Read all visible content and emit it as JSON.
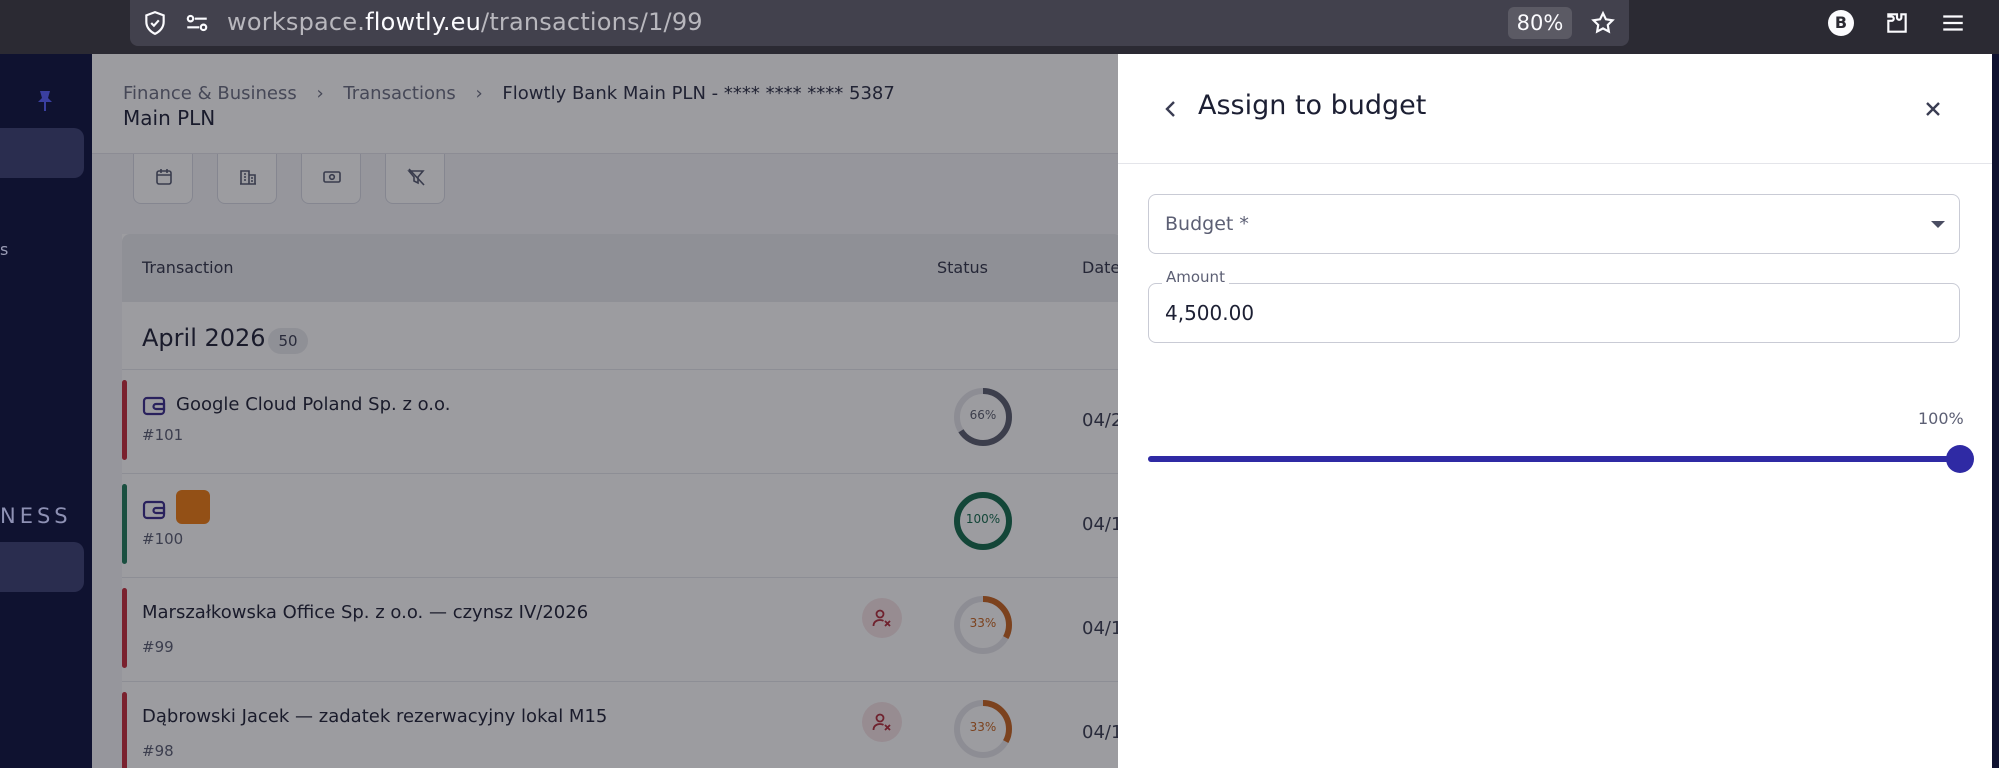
{
  "browser": {
    "url_prefix": "workspace.",
    "url_domain": "flowtly.eu",
    "url_path": "/transactions/1/99",
    "zoom": "80%",
    "profile_initial": "B"
  },
  "breadcrumb": {
    "items": [
      "Finance & Business",
      "Transactions",
      "Flowtly Bank Main PLN - **** **** **** 5387"
    ],
    "page_title": "Main PLN"
  },
  "sidebar": {
    "section_partial": "NESS",
    "item_partial": "s"
  },
  "table": {
    "columns": [
      "Transaction",
      "Status",
      "Date"
    ],
    "month": "April 2026",
    "month_count": "50",
    "rows": [
      {
        "name": "Google Cloud Poland Sp. z o.o.",
        "id": "#101",
        "status": "66%",
        "date": "04/2",
        "accent": "#c42b3c",
        "ring": "#5b5e6e",
        "progress": 0.66
      },
      {
        "name": "",
        "id": "#100",
        "status": "100%",
        "date": "04/1",
        "accent": "#1f7a5a",
        "ring": "#136b4d",
        "progress": 1.0
      },
      {
        "name": "Marszałkowska Office Sp. z o.o. — czynsz IV/2026",
        "id": "#99",
        "status": "33%",
        "date": "04/1",
        "accent": "#c42b3c",
        "ring": "#c8651f",
        "progress": 0.33
      },
      {
        "name": "Dąbrowski Jacek — zadatek rezerwacyjny lokal M15",
        "id": "#98",
        "status": "33%",
        "date": "04/1",
        "accent": "#c42b3c",
        "ring": "#c8651f",
        "progress": 0.33
      }
    ]
  },
  "drawer": {
    "title": "Assign to budget",
    "budget_label": "Budget *",
    "amount_label": "Amount",
    "amount_value": "4,500.00",
    "percent_label": "100%",
    "percent_value": 1.0,
    "accent": "#2f2aa4"
  }
}
